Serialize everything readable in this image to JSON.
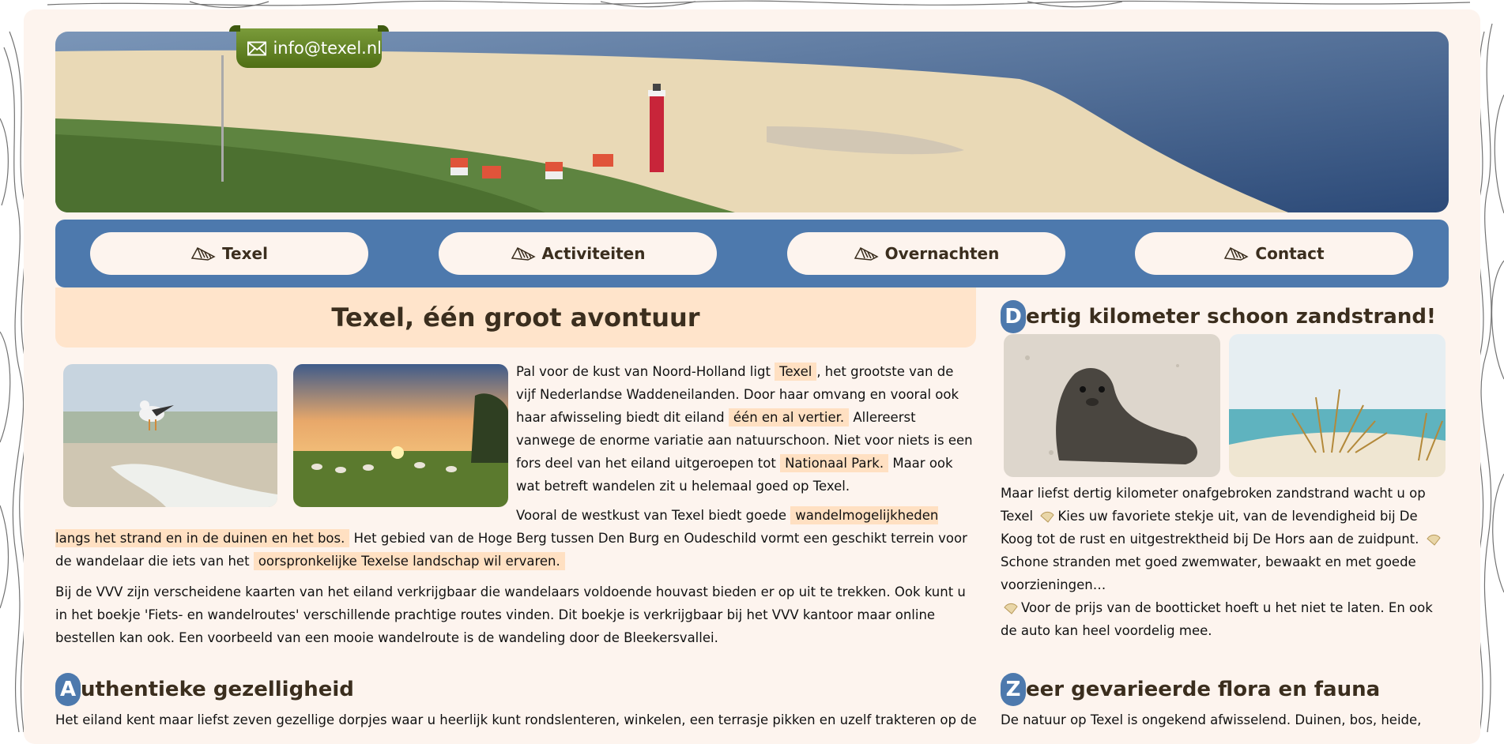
{
  "header": {
    "email": "info@texel.nl"
  },
  "nav": {
    "items": [
      {
        "label": "Texel"
      },
      {
        "label": "Activiteiten"
      },
      {
        "label": "Overnachten"
      },
      {
        "label": "Contact"
      }
    ]
  },
  "main": {
    "title": "Texel, één groot avontuur",
    "p1": {
      "t1": "Pal voor de kust van Noord-Holland ligt",
      "h1": "Texel",
      "t2": ", het grootste van de vijf Nederlandse Waddeneilanden. Door haar omvang en vooral ook haar afwisseling biedt dit eiland",
      "h2": "één en al vertier.",
      "t3": "Allereerst vanwege de enorme variatie aan natuurschoon. Niet voor niets is een fors deel van het eiland uitgeroepen tot",
      "h3": "Nationaal Park.",
      "t4": "Maar ook wat betreft wandelen zit u helemaal goed op Texel."
    },
    "p2": {
      "t1": "Vooral de westkust van Texel biedt goede",
      "h1": "wandelmogelijkheden langs het strand en in de duinen en het bos.",
      "t2": "Het gebied van de Hoge Berg tussen Den Burg en Oudeschild vormt een geschikt terrein voor de wandelaar die iets van het",
      "h2": "oorspronkelijke Texelse landschap wil ervaren."
    },
    "p3": "Bij de VVV zijn verscheidene kaarten van het eiland verkrijgbaar die wandelaars voldoende houvast bieden er op uit te trekken. Ook kunt u in het boekje 'Fiets- en wandelroutes' verschillende prachtige routes vinden. Dit boekje is verkrijgbaar bij het VVV kantoor maar online bestellen kan ook. Een voorbeeld van een mooie wandelroute is de wandeling door de Bleekersvallei."
  },
  "sections": {
    "beach": {
      "initial": "D",
      "rest": "ertig kilometer schoon zandstrand!",
      "s1": "Maar liefst dertig kilometer onafgebroken zandstrand wacht u op Texel",
      "s2": "Kies uw favoriete stekje uit, van de levendigheid bij De Koog tot de rust en uitgestrektheid bij De Hors aan de zuidpunt.",
      "s3": "Schone stranden met goed zwemwater, bewaakt en met goede voorzieningen…",
      "s4": "Voor de prijs van de bootticket hoeft u het niet te laten. En ook de auto kan heel voordelig mee."
    },
    "cozy": {
      "initial": "A",
      "rest": "uthentieke gezelligheid",
      "text": "Het eiland kent maar liefst zeven gezellige dorpjes waar u heerlijk kunt rondslenteren, winkelen, een terrasje pikken en uzelf trakteren op de vele"
    },
    "nature": {
      "initial": "Z",
      "rest": "eer gevarieerde flora en fauna",
      "text": "De natuur op Texel is ongekend afwisselend. Duinen, bos, heide,"
    }
  },
  "colors": {
    "nav": "#4d79ad",
    "title_bg": "#ffe4cb",
    "page_bg": "#fdf4ee",
    "mail_tab": "#5c7d1e"
  },
  "icons": {
    "email": "envelope-icon",
    "nav": "shell-icon",
    "bullet": "shell-icon"
  }
}
